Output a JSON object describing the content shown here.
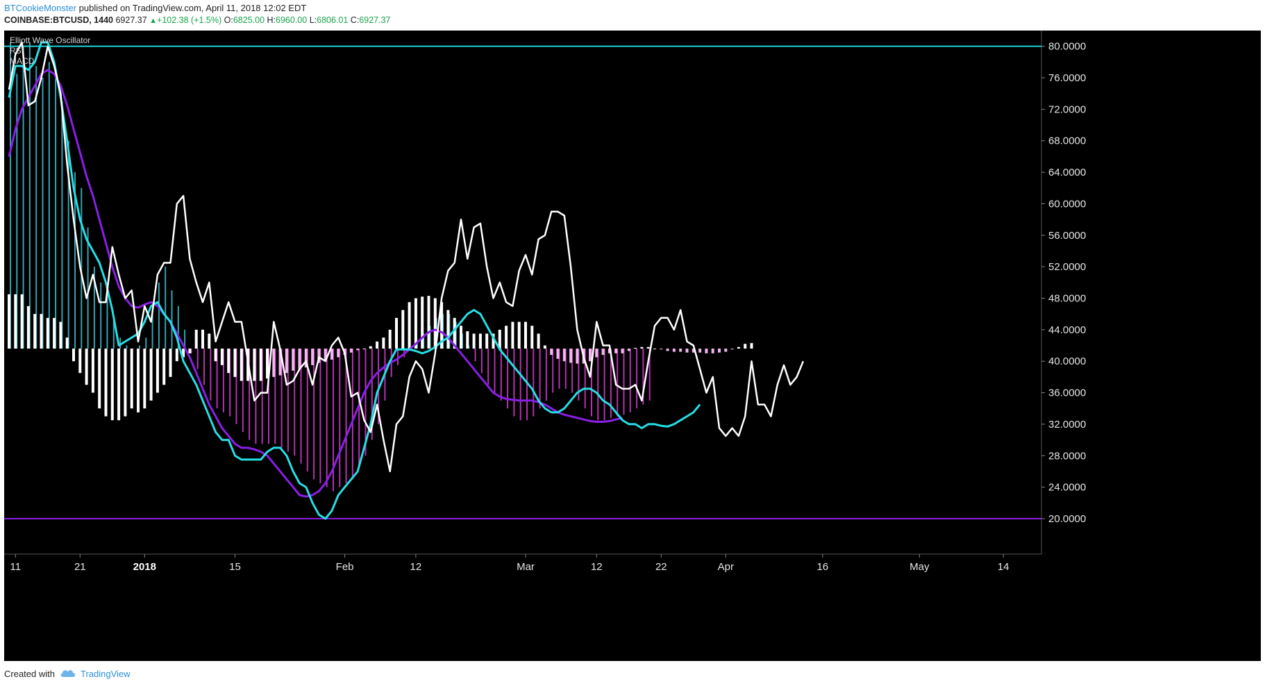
{
  "header": {
    "author": "BTCookieMonster",
    "published_text": "published on TradingView.com, April 11, 2018 12:02 EDT",
    "symbol": "COINBASE:BTCUSD, 1440",
    "last": "6927.37",
    "change": "+102.38 (+1.5%)",
    "open_label": "O:",
    "open": "6825.00",
    "high_label": "H:",
    "high": "6960.00",
    "low_label": "L:",
    "low": "6806.01",
    "close_label": "C:",
    "close": "6927.37"
  },
  "footer": {
    "created_with": "Created with",
    "brand": "TradingView"
  },
  "colors": {
    "background": "#000000",
    "rsi": "#ffffff",
    "fast_line": "#26e0e6",
    "slow_line": "#8a1fe6",
    "hist_positive_strong": "#3fc0d0",
    "hist_negative_strong": "#d63bd0",
    "hist_negative_weak": "#f2b6ee",
    "ewo_positive": "#ffffff",
    "ewo_negative_fading": "#f0c8f0",
    "level_upper": "#1fd2d8",
    "level_lower": "#8a1fe6"
  },
  "chart_data": {
    "type": "line",
    "legend": [
      "Elliott Wave Oscillator",
      "RSI",
      "MACD"
    ],
    "yaxis": {
      "ticks": [
        "80.0000",
        "76.0000",
        "72.0000",
        "68.0000",
        "64.0000",
        "60.0000",
        "56.0000",
        "52.0000",
        "48.0000",
        "44.0000",
        "40.0000",
        "36.0000",
        "32.0000",
        "28.0000",
        "24.0000",
        "20.0000"
      ],
      "range": [
        15.5,
        82
      ],
      "position": "right"
    },
    "xaxis": {
      "ticks": [
        {
          "label": "11",
          "bar": 1,
          "bold": false
        },
        {
          "label": "21",
          "bar": 11,
          "bold": false
        },
        {
          "label": "2018",
          "bar": 21,
          "bold": true
        },
        {
          "label": "15",
          "bar": 35,
          "bold": false
        },
        {
          "label": "Feb",
          "bar": 52,
          "bold": false
        },
        {
          "label": "12",
          "bar": 63,
          "bold": false
        },
        {
          "label": "Mar",
          "bar": 80,
          "bold": false
        },
        {
          "label": "12",
          "bar": 91,
          "bold": false
        },
        {
          "label": "22",
          "bar": 101,
          "bold": false
        },
        {
          "label": "Apr",
          "bar": 111,
          "bold": false
        },
        {
          "label": "16",
          "bar": 126,
          "bold": false
        },
        {
          "label": "May",
          "bar": 141,
          "bold": false
        },
        {
          "label": "14",
          "bar": 154,
          "bold": false
        }
      ],
      "bar_count_visible": 160
    },
    "levels": [
      {
        "value": 80,
        "color": "#1fd2d8"
      },
      {
        "value": 20,
        "color": "#8a1fe6"
      }
    ],
    "histogram_baseline": 41.6,
    "series": [
      {
        "name": "RSI",
        "color": "#ffffff",
        "values": [
          74.5,
          79,
          80.5,
          72.5,
          73,
          76,
          80,
          77.5,
          74,
          65,
          58,
          52,
          48,
          51,
          47.5,
          47.5,
          54.5,
          51,
          48,
          49,
          42.5,
          47,
          45,
          51,
          52.5,
          52.5,
          60,
          61,
          53,
          50,
          47.5,
          50,
          42.5,
          45,
          47.5,
          45,
          45,
          40,
          35,
          36,
          36,
          45,
          41.5,
          37,
          37.5,
          39,
          40,
          37,
          40.5,
          40,
          42,
          43,
          41,
          35.5,
          36,
          32.5,
          31,
          34.5,
          30,
          26,
          32,
          33,
          38,
          40,
          39,
          36,
          41,
          48,
          51.5,
          52.5,
          58,
          53,
          57,
          57.5,
          52,
          48,
          50,
          47.5,
          47,
          51.5,
          53.5,
          51,
          55.5,
          56,
          59,
          59,
          58.5,
          52,
          44,
          40.5,
          38,
          45,
          42,
          42,
          37,
          36.5,
          36.5,
          37,
          35,
          40,
          44.5,
          45.5,
          45.5,
          44,
          46.5,
          42.5,
          42,
          39,
          36,
          38,
          31.5,
          30.5,
          31.5,
          30.5,
          33,
          40,
          34.5,
          34.5,
          33,
          37,
          39.5,
          37,
          38,
          40
        ]
      },
      {
        "name": "",
        "color": "#26e0e6",
        "values": [
          73.5,
          77.5,
          77.5,
          77,
          78,
          80.5,
          80.5,
          78,
          73.5,
          68,
          62,
          58,
          55.5,
          54,
          52.5,
          50,
          46.5,
          42,
          42.5,
          43,
          43.5,
          45,
          47,
          47.5,
          46,
          45,
          43,
          40,
          38.5,
          37,
          35,
          33,
          31,
          30,
          30,
          28,
          27.5,
          27.5,
          27.5,
          27.5,
          28.5,
          29,
          29,
          28,
          26,
          24.5,
          24,
          22,
          20.5,
          20,
          21,
          23,
          24,
          25,
          26,
          29,
          32,
          36,
          38,
          40,
          41.5,
          41.5,
          41.5,
          41.3,
          41,
          41.3,
          41.8,
          42.5,
          43,
          44,
          45,
          46,
          46.5,
          46,
          44.5,
          43,
          41.5,
          40.5,
          39.5,
          38.5,
          37.5,
          36.5,
          35,
          34,
          33.5,
          33.5,
          34,
          35,
          36,
          36.5,
          36.5,
          36,
          35,
          34.5,
          33.5,
          32.5,
          32,
          32,
          31.5,
          32,
          32,
          31.8,
          31.7,
          32,
          32.5,
          33,
          33.5,
          34.5
        ]
      },
      {
        "name": "",
        "color": "#8a1fe6",
        "values": [
          66,
          69.5,
          72,
          73.5,
          75,
          76.5,
          77,
          76.5,
          75,
          72.5,
          69.5,
          66.5,
          63.5,
          61,
          58,
          55,
          52,
          49.5,
          48,
          47,
          46.8,
          47.2,
          47.5,
          47,
          46,
          45,
          43.5,
          42,
          40.5,
          38.5,
          36.5,
          34.5,
          33,
          31.5,
          30.5,
          29.5,
          29,
          29,
          28.8,
          28.5,
          28,
          27,
          26,
          25,
          24,
          23,
          22.8,
          23,
          23.5,
          24.5,
          26,
          28,
          30,
          32,
          34,
          36,
          37.5,
          38.5,
          39.2,
          39.8,
          40.2,
          40.8,
          41.5,
          42.2,
          43,
          43.7,
          44,
          43.7,
          43,
          42,
          41,
          40,
          39,
          38,
          37,
          36,
          35.5,
          35.2,
          35.1,
          35,
          35,
          35,
          34.8,
          34.5,
          34,
          33.5,
          33.2,
          33,
          32.8,
          32.6,
          32.4,
          32.3,
          32.3,
          32.4,
          32.6,
          32.8
        ]
      },
      {
        "name": "Elliott Wave Oscillator",
        "color": "#ffffff",
        "type": "bar",
        "values": [
          48.5,
          48.5,
          48.5,
          47,
          46,
          46,
          45.5,
          45.5,
          45,
          43,
          40,
          38.5,
          37,
          36,
          34,
          33,
          32.5,
          32.5,
          33,
          34,
          33.5,
          34,
          35,
          36,
          37,
          38,
          40,
          40.5,
          41,
          44,
          44,
          43.5,
          40,
          39.5,
          38.5,
          38,
          37.5,
          37.5,
          37.5,
          37.5,
          37.8,
          38,
          38.2,
          38.5,
          38.8,
          39,
          39.2,
          39.5,
          39.8,
          40,
          40.2,
          40.5,
          40.8,
          41.1,
          41.4,
          41.6,
          41.9,
          42.5,
          43,
          44,
          45.5,
          46.5,
          47.5,
          48,
          48.2,
          48.3,
          48,
          47.5,
          46.5,
          45.5,
          44.5,
          43.8,
          43.5,
          43.5,
          43.5,
          43.5,
          44,
          44.5,
          45,
          45,
          45,
          44.5,
          43.5,
          42,
          40.8,
          40.3,
          40,
          39.8,
          39.7,
          39.7,
          40,
          40.5,
          40.8,
          41,
          41,
          41,
          41.3,
          41.7,
          41.8,
          41.8,
          41.6,
          41.5,
          41.3,
          41.2,
          41.2,
          41.1,
          41.1,
          41.1,
          41,
          41,
          41.1,
          41.2,
          41.5,
          41.8,
          42.2,
          42.3
        ]
      },
      {
        "name": "MACD",
        "color": "#d63bd0",
        "type": "bar",
        "values": [
          80.5,
          76.5,
          80,
          80.5,
          77.5,
          76,
          78,
          76,
          73,
          68,
          64,
          62,
          57,
          52,
          50,
          48.5,
          45.5,
          43,
          42,
          41.5,
          42,
          43,
          46,
          50,
          52,
          49,
          47,
          44,
          41,
          39,
          37,
          35,
          34,
          33.5,
          33,
          32,
          31,
          30,
          29.5,
          29.5,
          29.5,
          29.5,
          29,
          28.5,
          28,
          27,
          26,
          25,
          24.5,
          24,
          23.5,
          24,
          24.5,
          25,
          26.5,
          28,
          30,
          32,
          35,
          38,
          39.5,
          40.5,
          41.5,
          42.5,
          43.5,
          44.5,
          45.5,
          46,
          46,
          45,
          43.5,
          42,
          40,
          38.5,
          37,
          36,
          35,
          34,
          33,
          32.5,
          32.5,
          33,
          34,
          35,
          36,
          36.5,
          36.5,
          36,
          35,
          34,
          33,
          32.5,
          32.5,
          32.8,
          33,
          33.2,
          33.5,
          34,
          34.5,
          35
        ]
      }
    ]
  }
}
